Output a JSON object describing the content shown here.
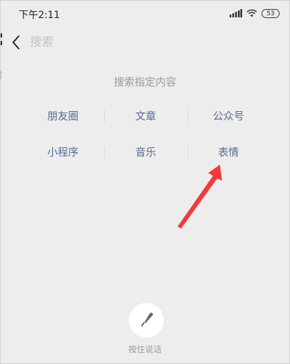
{
  "status_bar": {
    "time": "下午2:11",
    "battery": "53"
  },
  "search": {
    "placeholder": "搜索"
  },
  "section_title": "搜索指定内容",
  "categories": [
    [
      "朋友圈",
      "文章",
      "公众号"
    ],
    [
      "小程序",
      "音乐",
      "表情"
    ]
  ],
  "voice": {
    "label": "按住说话"
  },
  "colors": {
    "background": "#ededed",
    "link": "#586b95",
    "annotation_arrow": "#f23a3a"
  },
  "icons": {
    "back": "chevron-left-icon",
    "mic": "microphone-icon",
    "signal": "signal-icon",
    "wifi": "wifi-icon",
    "battery": "battery-icon"
  }
}
